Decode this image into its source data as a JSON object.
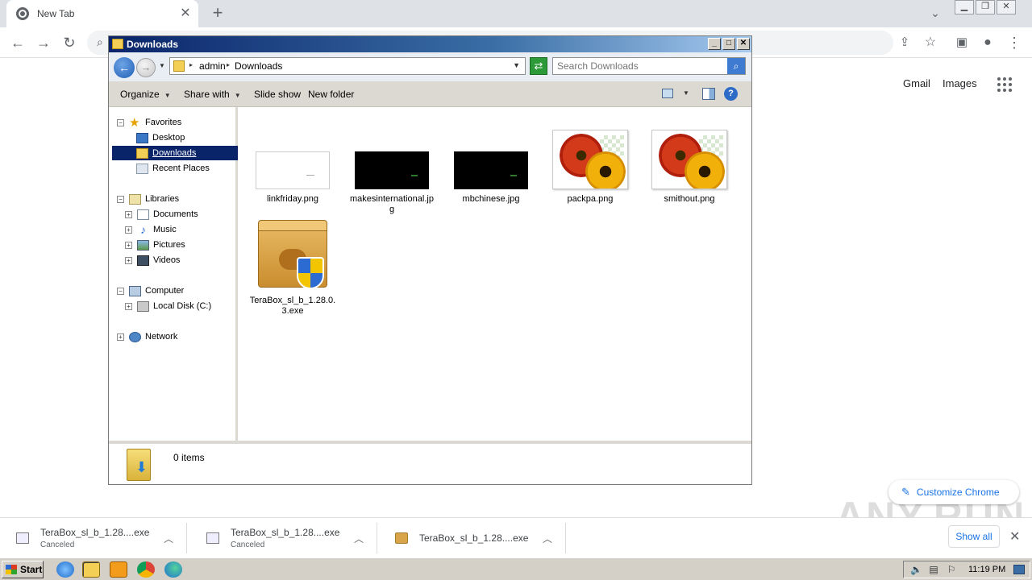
{
  "browser": {
    "tab_title": "New Tab",
    "tab_close": "✕",
    "new_tab": "+",
    "gmail": "Gmail",
    "images": "Images",
    "customize": "Customize Chrome",
    "watermark": "ANY.RUN"
  },
  "downloads": {
    "items": [
      {
        "name": "TeraBox_sl_b_1.28....exe",
        "status": "Canceled"
      },
      {
        "name": "TeraBox_sl_b_1.28....exe",
        "status": "Canceled"
      },
      {
        "name": "TeraBox_sl_b_1.28....exe",
        "status": ""
      }
    ],
    "show_all": "Show all"
  },
  "explorer": {
    "title": "Downloads",
    "breadcrumb": [
      "admin",
      "Downloads"
    ],
    "search_placeholder": "Search Downloads",
    "commands": {
      "organize": "Organize",
      "share_with": "Share with",
      "slide_show": "Slide show",
      "new_folder": "New folder"
    },
    "tree": {
      "favorites": "Favorites",
      "desktop": "Desktop",
      "downloads": "Downloads",
      "recent": "Recent Places",
      "libraries": "Libraries",
      "documents": "Documents",
      "music": "Music",
      "pictures": "Pictures",
      "videos": "Videos",
      "computer": "Computer",
      "local_disk": "Local Disk (C:)",
      "network": "Network"
    },
    "files": [
      {
        "name": "linkfriday.png"
      },
      {
        "name": "makesinternational.jpg"
      },
      {
        "name": "mbchinese.jpg"
      },
      {
        "name": "packpa.png"
      },
      {
        "name": "smithout.png"
      },
      {
        "name": "TeraBox_sl_b_1.28.0.3.exe"
      }
    ],
    "status": "0 items"
  },
  "taskbar": {
    "start": "Start",
    "clock": "11:19 PM"
  }
}
